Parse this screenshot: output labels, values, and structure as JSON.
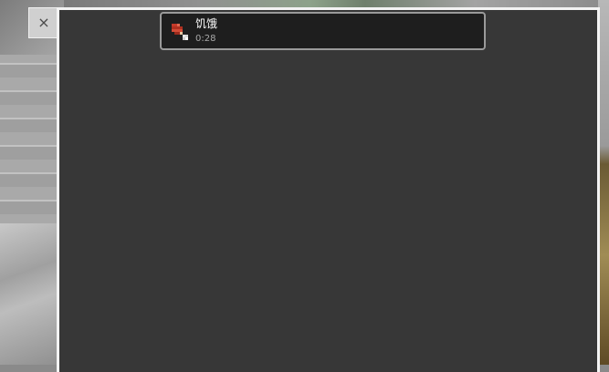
{
  "close_button": {
    "symbol": "×"
  },
  "effects": [
    {
      "name": "饥饿",
      "time": "0:28",
      "icon": "raw-meat-icon"
    }
  ],
  "colors": {
    "panel_background": "#373737",
    "panel_border": "#f3f3f3",
    "card_background": "#1e1e1e",
    "card_border": "#9a9a9a"
  }
}
